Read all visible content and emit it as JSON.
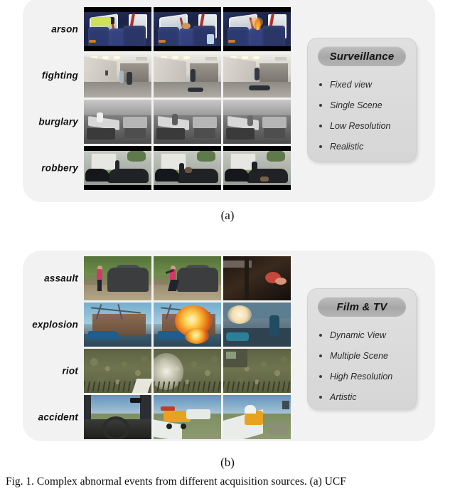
{
  "figure": {
    "caption": "Fig. 1.  Complex abnormal events from different acquisition sources. (a) UCF",
    "subcaption_a": "(a)",
    "subcaption_b": "(b)"
  },
  "panel_a": {
    "rows": [
      {
        "label": "arson",
        "frames": [
          "arson-frame-1",
          "arson-frame-2",
          "arson-frame-3"
        ]
      },
      {
        "label": "fighting",
        "frames": [
          "fighting-frame-1",
          "fighting-frame-2",
          "fighting-frame-3"
        ]
      },
      {
        "label": "burglary",
        "frames": [
          "burglary-frame-1",
          "burglary-frame-2",
          "burglary-frame-3"
        ]
      },
      {
        "label": "robbery",
        "frames": [
          "robbery-frame-1",
          "robbery-frame-2",
          "robbery-frame-3"
        ]
      }
    ],
    "card": {
      "title": "Surveillance",
      "features": [
        "Fixed view",
        "Single Scene",
        "Low Resolution",
        "Realistic"
      ]
    }
  },
  "panel_b": {
    "rows": [
      {
        "label": "assault",
        "frames": [
          "assault-frame-1",
          "assault-frame-2",
          "assault-frame-3"
        ]
      },
      {
        "label": "explosion",
        "frames": [
          "explosion-frame-1",
          "explosion-frame-2",
          "explosion-frame-3"
        ]
      },
      {
        "label": "riot",
        "frames": [
          "riot-frame-1",
          "riot-frame-2",
          "riot-frame-3"
        ]
      },
      {
        "label": "accident",
        "frames": [
          "accident-frame-1",
          "accident-frame-2",
          "accident-frame-3"
        ]
      }
    ],
    "card": {
      "title": "Film & TV",
      "features": [
        "Dynamic View",
        "Multiple Scene",
        "High Resolution",
        "Artistic"
      ]
    }
  },
  "colors": {
    "page_background": "#ffffff",
    "panel_background": "#f2f2f2",
    "card_background": "#dcdcdc",
    "pill_background": "#b0b0b0",
    "text": "#141414"
  }
}
